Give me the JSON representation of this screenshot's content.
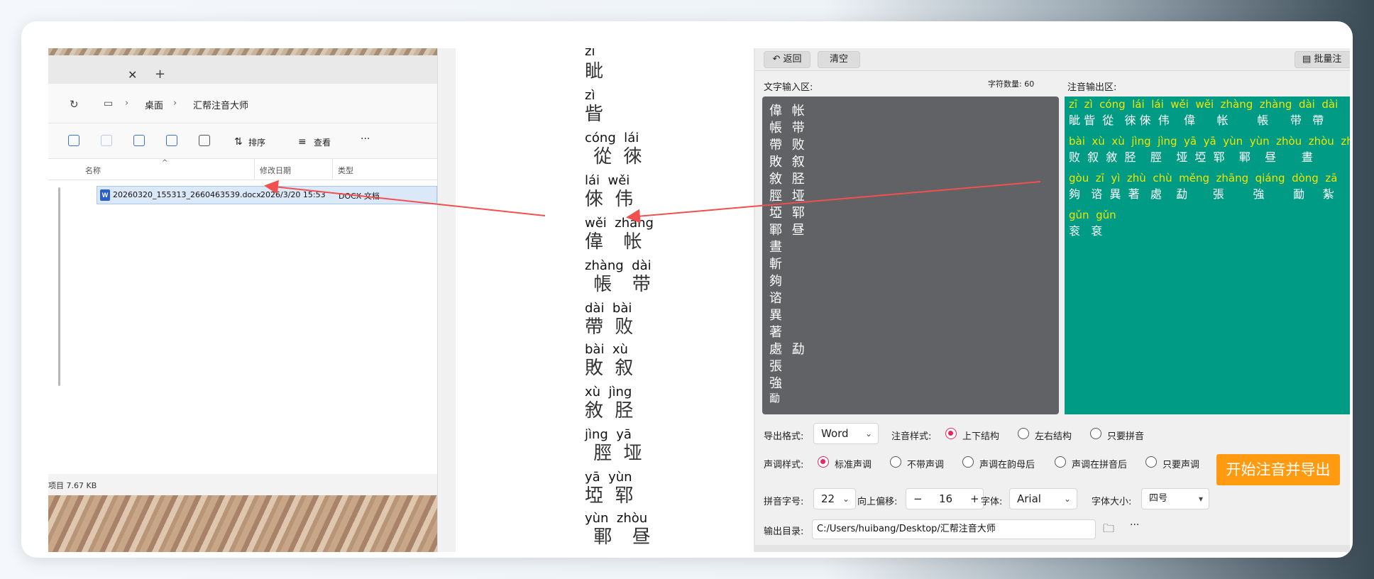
{
  "explorer": {
    "tab_close": "✕",
    "tab_add": "+",
    "breadcrumb": [
      "桌面",
      "汇帮注音大师"
    ],
    "toolbar": {
      "sort": "排序",
      "view": "查看",
      "more": "···"
    },
    "columns": {
      "name": "名称",
      "modified": "修改日期",
      "type": "类型"
    },
    "file": {
      "name": "20260320_155313_2660463539.docx",
      "date": "2026/3/20 15:53",
      "type": "DOCX 文档",
      "icon_text": "W"
    },
    "status": "项目  7.67 KB"
  },
  "document": {
    "lines": [
      {
        "py": "zī"
      },
      {
        "hz": "眦"
      },
      {
        "py": "zì"
      },
      {
        "hz": "眥"
      },
      {
        "py": "cóng  lái"
      },
      {
        "hz": " 從 徠"
      },
      {
        "py": "lái  wěi"
      },
      {
        "hz": "倈 伟"
      },
      {
        "py": "wěi  zhàng"
      },
      {
        "hz": "偉  帐"
      },
      {
        "py": "zhàng  dài"
      },
      {
        "hz": " 帳  带"
      },
      {
        "py": "dài  bài"
      },
      {
        "hz": "帶 败"
      },
      {
        "py": "bài  xù"
      },
      {
        "hz": "敗 叙"
      },
      {
        "py": "xù  jìng"
      },
      {
        "hz": "敘 胫"
      },
      {
        "py": "jìng  yā"
      },
      {
        "hz": " 脛 垭"
      },
      {
        "py": "yā  yùn"
      },
      {
        "hz": "埡 郓"
      },
      {
        "py": "yùn  zhòu"
      },
      {
        "hz": " 鄆  昼"
      }
    ]
  },
  "app": {
    "back_label": "返回",
    "clear_label": "清空",
    "batch_label": "批量注",
    "input_section": "文字输入区:",
    "char_count_label": "字符数量: 60",
    "output_section": "注音输出区:",
    "input_lines": [
      "偉 帐",
      "帳 带",
      "帶 败",
      "敗 叙",
      "敘 胫",
      "脛 垭",
      "埡 郓",
      "鄆 昼",
      "晝",
      "斬",
      "夠",
      "谘",
      "異",
      "著",
      "處 勐",
      "張",
      "強",
      "勔"
    ],
    "output_rows": [
      {
        "py": "zī  zì  cóng  lái  lái  wěi  wěi  zhàng  zhàng  dài  dài",
        "hz": "眦 眥  從   徠 倈  伟    偉      帐        帳      带   帶"
      },
      {
        "py": "bài  xù  xù  jìng  jìng  yā  yā  yùn  yùn  zhòu  zhòu  zh",
        "hz": "败  叙  敘  胫    脛    垭  埡  郓    鄆    昼       晝"
      },
      {
        "py": "gòu  zī  yì  zhù  chù  měng  zhāng  qiáng  dòng  zā",
        "hz": "夠   谘  異  著   處    勐       張        強        勔     紮"
      },
      {
        "py": "gǔn  gǔn",
        "hz": "衮   袞"
      }
    ],
    "export_format_label": "导出格式:",
    "export_format_value": "Word",
    "pinyin_style_label": "注音样式:",
    "pinyin_styles": [
      "上下结构",
      "左右结构",
      "只要拼音"
    ],
    "tone_style_label": "声调样式:",
    "tone_styles": [
      "标准声调",
      "不带声调",
      "声调在韵母后",
      "声调在拼音后",
      "只要声调"
    ],
    "pinyin_size_label": "拼音字号:",
    "pinyin_size_value": "22",
    "offset_label": "向上偏移:",
    "offset_value": "16",
    "offset_minus": "−",
    "offset_plus": "+",
    "font_label": "字体:",
    "font_value": "Arial",
    "font_size_label": "字体大小:",
    "font_size_value": "四号",
    "start_label": "开始注音并导出",
    "outdir_label": "输出目录:",
    "outdir_value": "C:/Users/huibang/Desktop/汇帮注音大师",
    "more": "···"
  },
  "colors": {
    "output_bg": "#009b84",
    "pinyin_yellow": "#f2e600",
    "accent": "#e7265f",
    "start_btn": "#ff9a11",
    "arrow": "#f05050"
  }
}
